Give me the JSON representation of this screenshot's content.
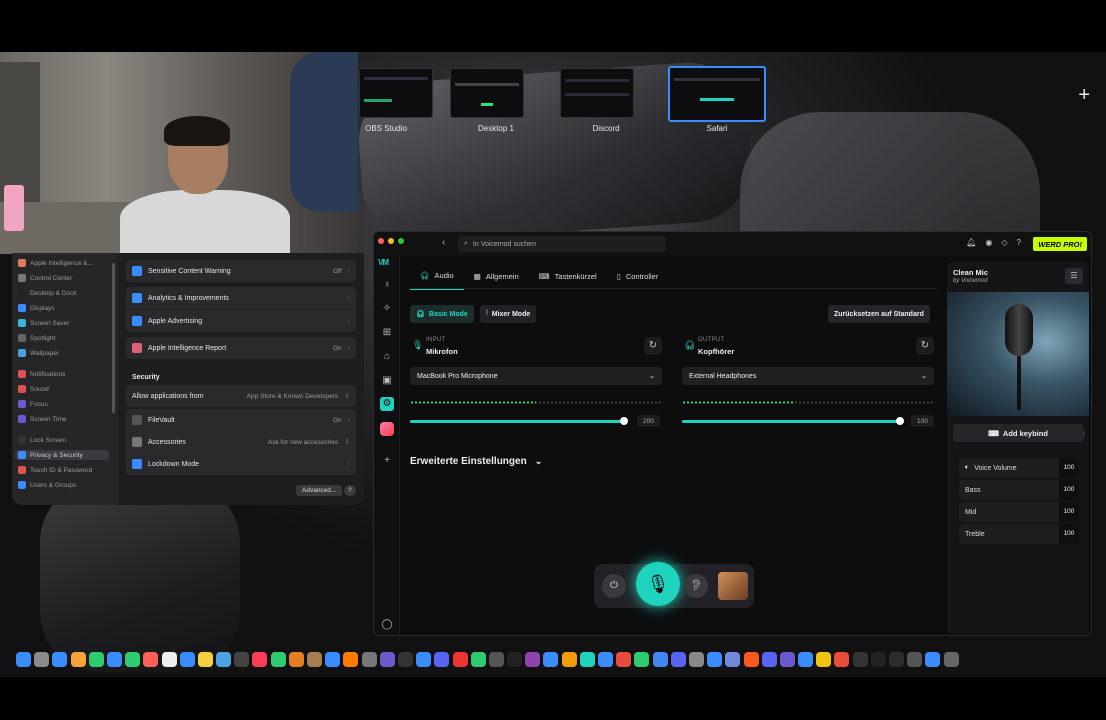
{
  "mission_control": {
    "spaces": [
      {
        "label": "OBS Studio",
        "active": false
      },
      {
        "label": "Desktop 1",
        "active": false
      },
      {
        "label": "Discord",
        "active": false
      },
      {
        "label": "Safari",
        "active": true
      }
    ],
    "add_icon": "+"
  },
  "settings": {
    "sidebar": [
      "Apple Intelligence &...",
      "Control Center",
      "Desktop & Dock",
      "Displays",
      "Screen Saver",
      "Spotlight",
      "Wallpaper",
      "Notifications",
      "Sound",
      "Focus",
      "Screen Time",
      "Lock Screen",
      "Privacy & Security",
      "Touch ID & Password",
      "Users & Groups"
    ],
    "rows": {
      "sensitive_content": {
        "label": "Sensitive Content Warning",
        "value": "Off"
      },
      "analytics": {
        "label": "Analytics & Improvements"
      },
      "apple_advertising": {
        "label": "Apple Advertising"
      },
      "ai_report": {
        "label": "Apple Intelligence Report",
        "value": "On"
      },
      "security_header": "Security",
      "allow_apps": {
        "label": "Allow applications from",
        "value": "App Store & Known Developers"
      },
      "filevault": {
        "label": "FileVault",
        "value": "On"
      },
      "accessories": {
        "label": "Accessories",
        "value": "Ask for new accessories"
      },
      "lockdown": {
        "label": "Lockdown Mode"
      }
    },
    "advanced_button": "Advanced...",
    "help_button": "?"
  },
  "voicemod": {
    "search_placeholder": "In Voicemod suchen",
    "pro_badge": "WERD PRO!",
    "tabs": [
      "Audio",
      "Allgemein",
      "Tastenkürzel",
      "Controller"
    ],
    "modes": {
      "basic": "Basic Mode",
      "mixer": "Mixer Mode"
    },
    "reset_button": "Zurücksetzen auf Standard",
    "input": {
      "caption": "INPUT",
      "name": "Mikrofon",
      "device": "MacBook Pro Microphone",
      "level": 0.5,
      "volume": 200,
      "volume_fraction": 0.98
    },
    "output": {
      "caption": "OUTPUT",
      "name": "Kopfhörer",
      "device": "External Headphones",
      "level": 0.44,
      "volume": 100,
      "volume_fraction": 0.98
    },
    "advanced_settings": "Erweiterte Einstellungen",
    "voice": {
      "title": "Clean Mic",
      "subtitle": "by Voicemod",
      "keybind_button": "Add keybind",
      "params": [
        {
          "label": "Voice Volume",
          "value": "100"
        },
        {
          "label": "Bass",
          "value": "100"
        },
        {
          "label": "Mid",
          "value": "100"
        },
        {
          "label": "Treble",
          "value": "100"
        }
      ]
    }
  },
  "colors": {
    "accent": "#1fd3bf",
    "pro": "#c6ff00",
    "meter": "#2be37b",
    "selection": "#3a8cff"
  }
}
